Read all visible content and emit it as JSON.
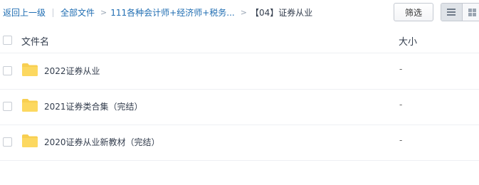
{
  "breadcrumb": {
    "back": "返回上一级",
    "root": "全部文件",
    "parent": "111各种会计师+经济师+税务...",
    "current": "【04】证券从业"
  },
  "toolbar": {
    "filter_label": "筛选",
    "views": [
      {
        "icon": "list-icon",
        "active": true
      },
      {
        "icon": "grid-icon",
        "active": false
      }
    ]
  },
  "table": {
    "columns": [
      "文件名",
      "大小"
    ],
    "rows": [
      {
        "name": "2022证券从业",
        "size": "-",
        "icon": "folder-icon"
      },
      {
        "name": "2021证券类合集（完结）",
        "size": "-",
        "icon": "folder-icon"
      },
      {
        "name": "2020证券从业新教材（完结）",
        "size": "-",
        "icon": "folder-icon"
      }
    ]
  },
  "colors": {
    "link": "#1f6db2",
    "folder": "#f8cf51",
    "divider": "#eef0f3"
  }
}
